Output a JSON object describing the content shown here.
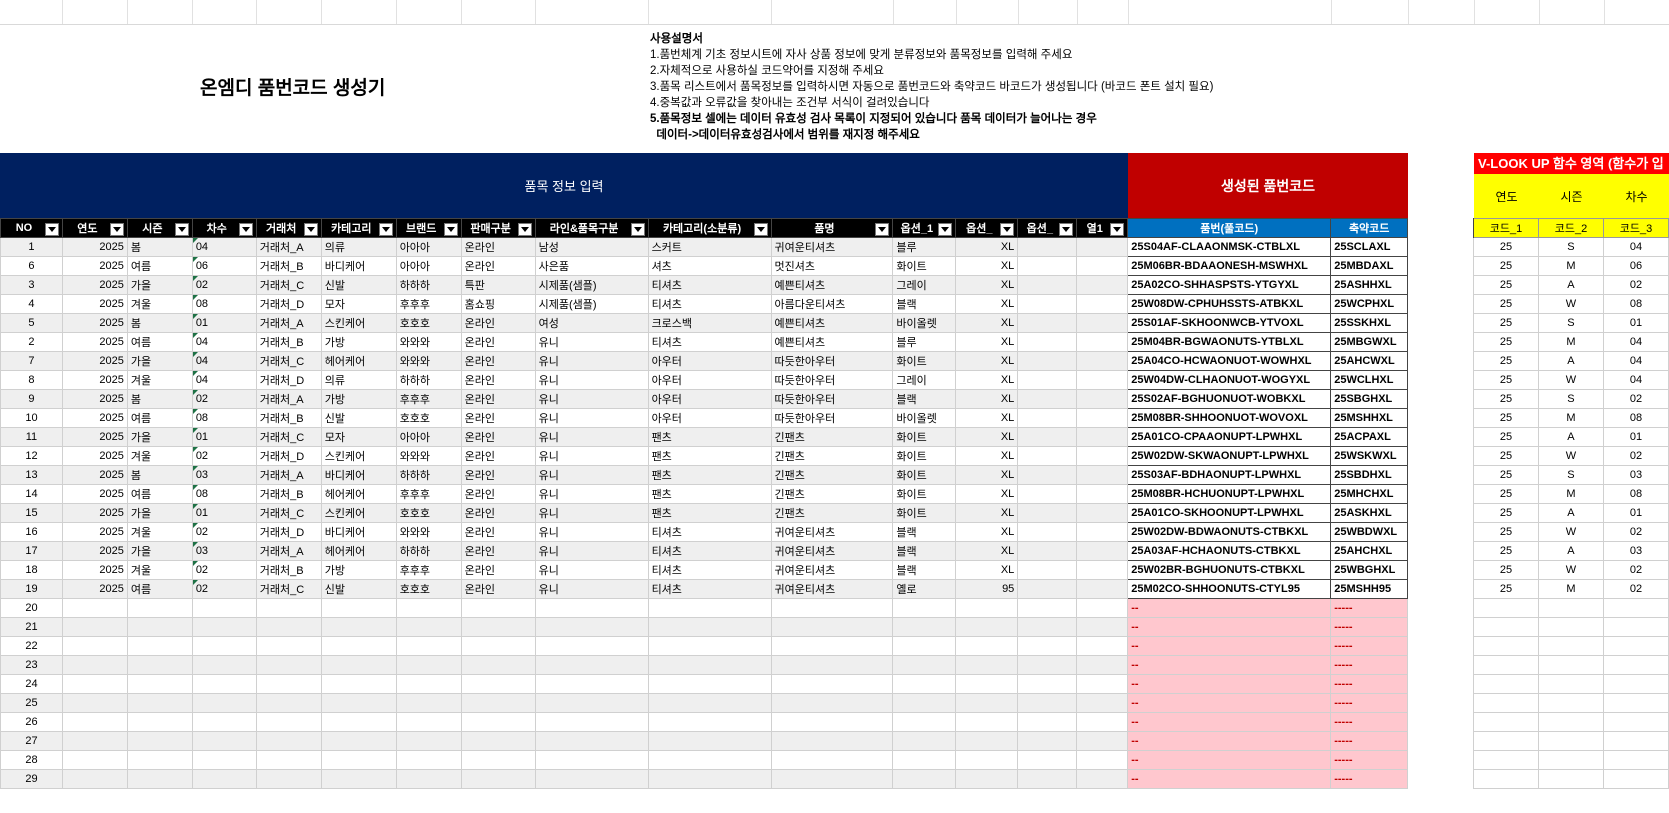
{
  "title": "온엠디 품번코드 생성기",
  "instructions": [
    "사용설명서",
    "1.품번체계 기초 정보시트에 자사 상품 정보에 맞게 분류정보와 품목정보를 입력해 주세요",
    "2.자체적으로 사용하실 코드약어를 지정해 주세요",
    "3.품목 리스트에서 품목정보를 입력하시면 자동으로 품번코드와 축약코드 바코드가 생성됩니다 (바코드 폰트 설치 필요)",
    "4.중복값과 오류값을 찾아내는 조건부 서식이 걸려있습니다",
    "5.품목정보 셀에는 데이터 유효성 검사 목록이 지정되어 있습니다 품목 데이터가 늘어나는 경우",
    "  데이터->데이터유효성검사에서 범위를 재지정 해주세요"
  ],
  "section_item_info": "품목 정보 입력",
  "section_generated": "생성된 품번코드",
  "section_vlookup": "V-LOOK UP 함수 영역 (함수가 입",
  "vlookup_heads": [
    "연도",
    "시즌",
    "차수"
  ],
  "vlookup_codes": [
    "코드_1",
    "코드_2",
    "코드_3"
  ],
  "columns": [
    "NO",
    "연도",
    "시즌",
    "차수",
    "거래처",
    "카테고리",
    "브랜드",
    "판매구분",
    "라인&품목구분",
    "카테고리(소분류)",
    "품명",
    "옵션_1",
    "옵션_",
    "옵션_",
    "열1"
  ],
  "code_columns": [
    "품번(풀코드)",
    "축약코드"
  ],
  "rows": [
    {
      "no": "1",
      "year": "2025",
      "season": "봄",
      "cha": "04",
      "vendor": "거래처_A",
      "cat": "의류",
      "brand": "아아아",
      "sale": "온라인",
      "line": "남성",
      "sub": "스커트",
      "name": "귀여운티셔츠",
      "opt1": "블루",
      "opt2": "XL",
      "full": "25S04AF-CLAAONMSK-CTBLXL",
      "short": "25SCLAXL",
      "vy": "25",
      "vs": "S",
      "vc": "04"
    },
    {
      "no": "6",
      "year": "2025",
      "season": "여름",
      "cha": "06",
      "vendor": "거래처_B",
      "cat": "바디케어",
      "brand": "아아아",
      "sale": "온라인",
      "line": "사은품",
      "sub": "셔츠",
      "name": "멋진셔츠",
      "opt1": "화이트",
      "opt2": "XL",
      "full": "25M06BR-BDAAONESH-MSWHXL",
      "short": "25MBDAXL",
      "vy": "25",
      "vs": "M",
      "vc": "06"
    },
    {
      "no": "3",
      "year": "2025",
      "season": "가을",
      "cha": "02",
      "vendor": "거래처_C",
      "cat": "신발",
      "brand": "하하하",
      "sale": "특판",
      "line": "시제품(샘플)",
      "sub": "티셔츠",
      "name": "예쁜티셔츠",
      "opt1": "그레이",
      "opt2": "XL",
      "full": "25A02CO-SHHASPSTS-YTGYXL",
      "short": "25ASHHXL",
      "vy": "25",
      "vs": "A",
      "vc": "02"
    },
    {
      "no": "4",
      "year": "2025",
      "season": "겨울",
      "cha": "08",
      "vendor": "거래처_D",
      "cat": "모자",
      "brand": "후후후",
      "sale": "홈쇼핑",
      "line": "시제품(샘플)",
      "sub": "티셔츠",
      "name": "아름다운티셔츠",
      "opt1": "블랙",
      "opt2": "XL",
      "full": "25W08DW-CPHUHSSTS-ATBKXL",
      "short": "25WCPHXL",
      "vy": "25",
      "vs": "W",
      "vc": "08"
    },
    {
      "no": "5",
      "year": "2025",
      "season": "봄",
      "cha": "01",
      "vendor": "거래처_A",
      "cat": "스킨케어",
      "brand": "호호호",
      "sale": "온라인",
      "line": "여성",
      "sub": "크로스백",
      "name": "예쁜티셔츠",
      "opt1": "바이올렛",
      "opt2": "XL",
      "full": "25S01AF-SKHOONWCB-YTVOXL",
      "short": "25SSKHXL",
      "vy": "25",
      "vs": "S",
      "vc": "01"
    },
    {
      "no": "2",
      "year": "2025",
      "season": "여름",
      "cha": "04",
      "vendor": "거래처_B",
      "cat": "가방",
      "brand": "와와와",
      "sale": "온라인",
      "line": "유니",
      "sub": "티셔츠",
      "name": "예쁜티셔츠",
      "opt1": "블루",
      "opt2": "XL",
      "full": "25M04BR-BGWAONUTS-YTBLXL",
      "short": "25MBGWXL",
      "vy": "25",
      "vs": "M",
      "vc": "04"
    },
    {
      "no": "7",
      "year": "2025",
      "season": "가을",
      "cha": "04",
      "vendor": "거래처_C",
      "cat": "헤어케어",
      "brand": "와와와",
      "sale": "온라인",
      "line": "유니",
      "sub": "아우터",
      "name": "따듯한아우터",
      "opt1": "화이트",
      "opt2": "XL",
      "full": "25A04CO-HCWAONUOT-WOWHXL",
      "short": "25AHCWXL",
      "vy": "25",
      "vs": "A",
      "vc": "04"
    },
    {
      "no": "8",
      "year": "2025",
      "season": "겨울",
      "cha": "04",
      "vendor": "거래처_D",
      "cat": "의류",
      "brand": "하하하",
      "sale": "온라인",
      "line": "유니",
      "sub": "아우터",
      "name": "따듯한아우터",
      "opt1": "그레이",
      "opt2": "XL",
      "full": "25W04DW-CLHAONUOT-WOGYXL",
      "short": "25WCLHXL",
      "vy": "25",
      "vs": "W",
      "vc": "04"
    },
    {
      "no": "9",
      "year": "2025",
      "season": "봄",
      "cha": "02",
      "vendor": "거래처_A",
      "cat": "가방",
      "brand": "후후후",
      "sale": "온라인",
      "line": "유니",
      "sub": "아우터",
      "name": "따듯한아우터",
      "opt1": "블랙",
      "opt2": "XL",
      "full": "25S02AF-BGHUONUOT-WOBKXL",
      "short": "25SBGHXL",
      "vy": "25",
      "vs": "S",
      "vc": "02"
    },
    {
      "no": "10",
      "year": "2025",
      "season": "여름",
      "cha": "08",
      "vendor": "거래처_B",
      "cat": "신발",
      "brand": "호호호",
      "sale": "온라인",
      "line": "유니",
      "sub": "아우터",
      "name": "따듯한아우터",
      "opt1": "바이올렛",
      "opt2": "XL",
      "full": "25M08BR-SHHOONUOT-WOVOXL",
      "short": "25MSHHXL",
      "vy": "25",
      "vs": "M",
      "vc": "08"
    },
    {
      "no": "11",
      "year": "2025",
      "season": "가을",
      "cha": "01",
      "vendor": "거래처_C",
      "cat": "모자",
      "brand": "아아아",
      "sale": "온라인",
      "line": "유니",
      "sub": "팬츠",
      "name": "긴팬츠",
      "opt1": "화이트",
      "opt2": "XL",
      "full": "25A01CO-CPAAONUPT-LPWHXL",
      "short": "25ACPAXL",
      "vy": "25",
      "vs": "A",
      "vc": "01"
    },
    {
      "no": "12",
      "year": "2025",
      "season": "겨울",
      "cha": "02",
      "vendor": "거래처_D",
      "cat": "스킨케어",
      "brand": "와와와",
      "sale": "온라인",
      "line": "유니",
      "sub": "팬츠",
      "name": "긴팬츠",
      "opt1": "화이트",
      "opt2": "XL",
      "full": "25W02DW-SKWAONUPT-LPWHXL",
      "short": "25WSKWXL",
      "vy": "25",
      "vs": "W",
      "vc": "02"
    },
    {
      "no": "13",
      "year": "2025",
      "season": "봄",
      "cha": "03",
      "vendor": "거래처_A",
      "cat": "바디케어",
      "brand": "하하하",
      "sale": "온라인",
      "line": "유니",
      "sub": "팬츠",
      "name": "긴팬츠",
      "opt1": "화이트",
      "opt2": "XL",
      "full": "25S03AF-BDHAONUPT-LPWHXL",
      "short": "25SBDHXL",
      "vy": "25",
      "vs": "S",
      "vc": "03"
    },
    {
      "no": "14",
      "year": "2025",
      "season": "여름",
      "cha": "08",
      "vendor": "거래처_B",
      "cat": "헤어케어",
      "brand": "후후후",
      "sale": "온라인",
      "line": "유니",
      "sub": "팬츠",
      "name": "긴팬츠",
      "opt1": "화이트",
      "opt2": "XL",
      "full": "25M08BR-HCHUONUPT-LPWHXL",
      "short": "25MHCHXL",
      "vy": "25",
      "vs": "M",
      "vc": "08"
    },
    {
      "no": "15",
      "year": "2025",
      "season": "가을",
      "cha": "01",
      "vendor": "거래처_C",
      "cat": "스킨케어",
      "brand": "호호호",
      "sale": "온라인",
      "line": "유니",
      "sub": "팬츠",
      "name": "긴팬츠",
      "opt1": "화이트",
      "opt2": "XL",
      "full": "25A01CO-SKHOONUPT-LPWHXL",
      "short": "25ASKHXL",
      "vy": "25",
      "vs": "A",
      "vc": "01"
    },
    {
      "no": "16",
      "year": "2025",
      "season": "겨울",
      "cha": "02",
      "vendor": "거래처_D",
      "cat": "바디케어",
      "brand": "와와와",
      "sale": "온라인",
      "line": "유니",
      "sub": "티셔츠",
      "name": "귀여운티셔츠",
      "opt1": "블랙",
      "opt2": "XL",
      "full": "25W02DW-BDWAONUTS-CTBKXL",
      "short": "25WBDWXL",
      "vy": "25",
      "vs": "W",
      "vc": "02"
    },
    {
      "no": "17",
      "year": "2025",
      "season": "가을",
      "cha": "03",
      "vendor": "거래처_A",
      "cat": "헤어케어",
      "brand": "하하하",
      "sale": "온라인",
      "line": "유니",
      "sub": "티셔츠",
      "name": "귀여운티셔츠",
      "opt1": "블랙",
      "opt2": "XL",
      "full": "25A03AF-HCHAONUTS-CTBKXL",
      "short": "25AHCHXL",
      "vy": "25",
      "vs": "A",
      "vc": "03"
    },
    {
      "no": "18",
      "year": "2025",
      "season": "겨울",
      "cha": "02",
      "vendor": "거래처_B",
      "cat": "가방",
      "brand": "후후후",
      "sale": "온라인",
      "line": "유니",
      "sub": "티셔츠",
      "name": "귀여운티셔츠",
      "opt1": "블랙",
      "opt2": "XL",
      "full": "25W02BR-BGHUONUTS-CTBKXL",
      "short": "25WBGHXL",
      "vy": "25",
      "vs": "W",
      "vc": "02"
    },
    {
      "no": "19",
      "year": "2025",
      "season": "여름",
      "cha": "02",
      "vendor": "거래처_C",
      "cat": "신발",
      "brand": "호호호",
      "sale": "온라인",
      "line": "유니",
      "sub": "티셔츠",
      "name": "귀여운티셔츠",
      "opt1": "옐로",
      "opt2": "95",
      "full": "25M02CO-SHHOONUTS-CTYL95",
      "short": "25MSHH95",
      "vy": "25",
      "vs": "M",
      "vc": "02"
    }
  ],
  "empty_rows": [
    "20",
    "21",
    "22",
    "23",
    "24",
    "25",
    "26",
    "27",
    "28",
    "29"
  ],
  "empty_full": "--",
  "empty_short": "-----",
  "colors": {
    "navy": "#002060",
    "red": "#c00000",
    "blue_header": "#0070c0",
    "vlookup_red": "#ff0000",
    "yellow": "#ffff00",
    "pink": "#ffc7ce"
  }
}
